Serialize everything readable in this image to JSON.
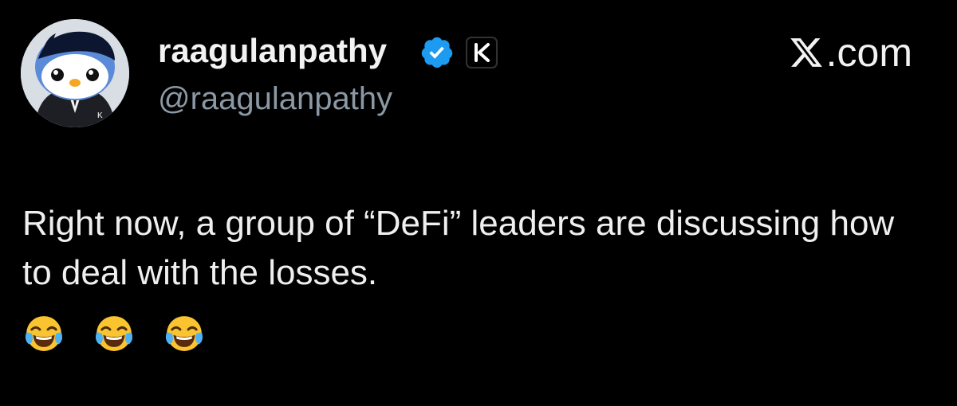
{
  "header": {
    "display_name": "raagulanpathy",
    "handle": "@raagulanpathy",
    "brand_text": ".com"
  },
  "badges": {
    "verified_icon": "verified-check-icon",
    "affiliate_icon": "k-affiliate-icon",
    "verified_color": "#1d9bf0"
  },
  "tweet": {
    "text": "Right now, a group of “DeFi” leaders are discussing how to deal with the losses.",
    "emojis": [
      "face-with-tears-of-joy",
      "face-with-tears-of-joy",
      "face-with-tears-of-joy"
    ]
  },
  "theme": {
    "background": "#000000",
    "text": "#e7e9ea",
    "muted": "#8b98a5"
  }
}
